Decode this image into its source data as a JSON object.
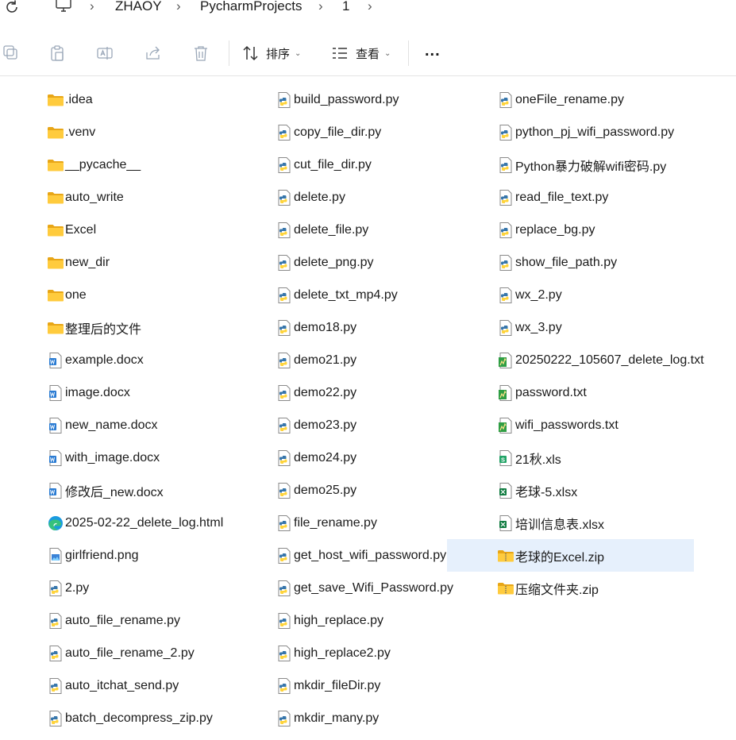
{
  "address_bar": {
    "segments": [
      "ZHAOY",
      "PycharmProjects",
      "1"
    ]
  },
  "toolbar": {
    "sort_label": "排序",
    "view_label": "查看",
    "more_label": "..."
  },
  "columns": [
    [
      {
        "name": ".idea",
        "icon": "folder-icon"
      },
      {
        "name": ".venv",
        "icon": "folder-icon"
      },
      {
        "name": "__pycache__",
        "icon": "folder-icon"
      },
      {
        "name": "auto_write",
        "icon": "folder-icon"
      },
      {
        "name": "Excel",
        "icon": "folder-icon"
      },
      {
        "name": "new_dir",
        "icon": "folder-icon"
      },
      {
        "name": "one",
        "icon": "folder-icon"
      },
      {
        "name": "整理后的文件",
        "icon": "folder-icon"
      },
      {
        "name": "example.docx",
        "icon": "word-doc-icon"
      },
      {
        "name": "image.docx",
        "icon": "word-doc-icon"
      },
      {
        "name": "new_name.docx",
        "icon": "word-doc-icon"
      },
      {
        "name": "with_image.docx",
        "icon": "word-doc-icon"
      },
      {
        "name": "修改后_new.docx",
        "icon": "word-doc-icon"
      },
      {
        "name": "2025-02-22_delete_log.html",
        "icon": "edge-html-icon"
      },
      {
        "name": "girlfriend.png",
        "icon": "image-file-icon"
      },
      {
        "name": "2.py",
        "icon": "python-file-icon"
      },
      {
        "name": "auto_file_rename.py",
        "icon": "python-file-icon"
      },
      {
        "name": "auto_file_rename_2.py",
        "icon": "python-file-icon"
      },
      {
        "name": "auto_itchat_send.py",
        "icon": "python-file-icon"
      },
      {
        "name": "batch_decompress_zip.py",
        "icon": "python-file-icon"
      }
    ],
    [
      {
        "name": "build_password.py",
        "icon": "python-file-icon"
      },
      {
        "name": "copy_file_dir.py",
        "icon": "python-file-icon"
      },
      {
        "name": "cut_file_dir.py",
        "icon": "python-file-icon"
      },
      {
        "name": "delete.py",
        "icon": "python-file-icon"
      },
      {
        "name": "delete_file.py",
        "icon": "python-file-icon"
      },
      {
        "name": "delete_png.py",
        "icon": "python-file-icon"
      },
      {
        "name": "delete_txt_mp4.py",
        "icon": "python-file-icon"
      },
      {
        "name": "demo18.py",
        "icon": "python-file-icon"
      },
      {
        "name": "demo21.py",
        "icon": "python-file-icon"
      },
      {
        "name": "demo22.py",
        "icon": "python-file-icon"
      },
      {
        "name": "demo23.py",
        "icon": "python-file-icon"
      },
      {
        "name": "demo24.py",
        "icon": "python-file-icon"
      },
      {
        "name": "demo25.py",
        "icon": "python-file-icon"
      },
      {
        "name": "file_rename.py",
        "icon": "python-file-icon"
      },
      {
        "name": "get_host_wifi_password.py",
        "icon": "python-file-icon"
      },
      {
        "name": "get_save_Wifi_Password.py",
        "icon": "python-file-icon"
      },
      {
        "name": "high_replace.py",
        "icon": "python-file-icon"
      },
      {
        "name": "high_replace2.py",
        "icon": "python-file-icon"
      },
      {
        "name": "mkdir_fileDir.py",
        "icon": "python-file-icon"
      },
      {
        "name": "mkdir_many.py",
        "icon": "python-file-icon"
      }
    ],
    [
      {
        "name": "oneFile_rename.py",
        "icon": "python-file-icon"
      },
      {
        "name": "python_pj_wifi_password.py",
        "icon": "python-file-icon"
      },
      {
        "name": "Python暴力破解wifi密码.py",
        "icon": "python-file-icon"
      },
      {
        "name": "read_file_text.py",
        "icon": "python-file-icon"
      },
      {
        "name": "replace_bg.py",
        "icon": "python-file-icon"
      },
      {
        "name": "show_file_path.py",
        "icon": "python-file-icon"
      },
      {
        "name": "wx_2.py",
        "icon": "python-file-icon"
      },
      {
        "name": "wx_3.py",
        "icon": "python-file-icon"
      },
      {
        "name": "20250222_105607_delete_log.txt",
        "icon": "text-file-icon"
      },
      {
        "name": "password.txt",
        "icon": "text-file-icon"
      },
      {
        "name": "wifi_passwords.txt",
        "icon": "text-file-icon"
      },
      {
        "name": "21秋.xls",
        "icon": "excel-xls-icon"
      },
      {
        "name": "老球-5.xlsx",
        "icon": "excel-xlsx-icon"
      },
      {
        "name": "培训信息表.xlsx",
        "icon": "excel-xlsx-icon"
      },
      {
        "name": "老球的Excel.zip",
        "icon": "zip-folder-icon",
        "selected": true
      },
      {
        "name": "压缩文件夹.zip",
        "icon": "zip-folder-icon"
      }
    ]
  ]
}
